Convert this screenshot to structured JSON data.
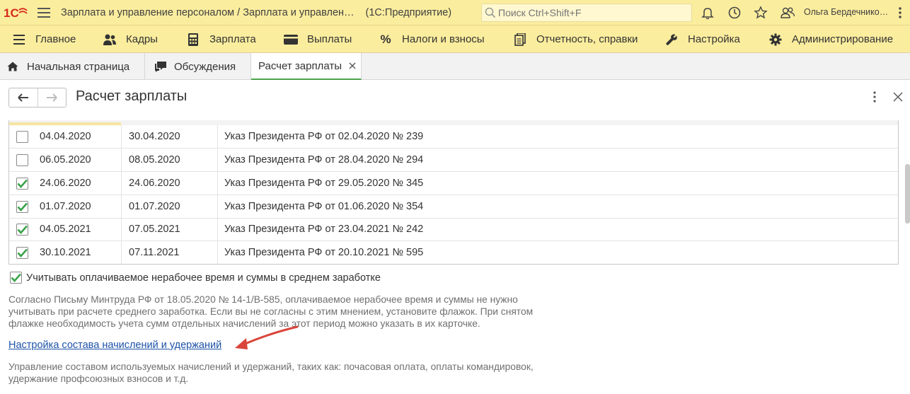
{
  "app": {
    "logo_text": "1С",
    "title": "Зарплата и управление персоналом / Зарплата и управлен…",
    "platform": "(1С:Предприятие)",
    "search_placeholder": "Поиск Ctrl+Shift+F",
    "user": "Ольга Бердечнико…"
  },
  "sections": [
    {
      "label": "Главное",
      "icon": "list-icon"
    },
    {
      "label": "Кадры",
      "icon": "people-icon"
    },
    {
      "label": "Зарплата",
      "icon": "calculator-icon"
    },
    {
      "label": "Выплаты",
      "icon": "wallet-icon"
    },
    {
      "label": "Налоги и взносы",
      "icon": "percent-icon"
    },
    {
      "label": "Отчетность, справки",
      "icon": "documents-icon"
    },
    {
      "label": "Настройка",
      "icon": "wrench-icon"
    },
    {
      "label": "Администрирование",
      "icon": "gear-icon"
    }
  ],
  "tabs": [
    {
      "label": "Начальная страница",
      "icon": "home-icon"
    },
    {
      "label": "Обсуждения",
      "icon": "chat-icon"
    },
    {
      "label": "Расчет зарплаты",
      "active": true
    }
  ],
  "form": {
    "title": "Расчет зарплаты"
  },
  "rows": [
    {
      "checked": false,
      "date_from": "04.04.2020",
      "date_to": "30.04.2020",
      "document": "Указ Президента РФ от 02.04.2020 № 239"
    },
    {
      "checked": false,
      "date_from": "06.05.2020",
      "date_to": "08.05.2020",
      "document": "Указ Президента РФ от 28.04.2020 № 294"
    },
    {
      "checked": true,
      "date_from": "24.06.2020",
      "date_to": "24.06.2020",
      "document": "Указ Президента РФ от 29.05.2020 № 345"
    },
    {
      "checked": true,
      "date_from": "01.07.2020",
      "date_to": "01.07.2020",
      "document": "Указ Президента РФ от 01.06.2020 № 354"
    },
    {
      "checked": true,
      "date_from": "04.05.2021",
      "date_to": "07.05.2021",
      "document": "Указ Президента РФ от 23.04.2021 № 242"
    },
    {
      "checked": true,
      "date_from": "30.10.2021",
      "date_to": "07.11.2021",
      "document": "Указ Президента РФ от 20.10.2021 № 595"
    }
  ],
  "option": {
    "checked": true,
    "label": "Учитывать оплачиваемое нерабочее время и суммы в среднем заработке"
  },
  "note1": [
    "Согласно Письму Минтруда РФ от 18.05.2020 № 14-1/В-585, оплачиваемое нерабочее время и суммы не нужно",
    "учитывать при расчете среднего заработка. Если вы не согласны с этим мнением, установите флажок. При снятом",
    "флажке необходимость учета сумм отдельных начислений за этот период можно указать в их карточке."
  ],
  "link": "Настройка состава начислений и удержаний",
  "note2": [
    "Управление составом используемых начислений и удержаний, таких как: почасовая оплата, оплаты командировок,",
    "удержание профсоюзных взносов и т.д."
  ],
  "colors": {
    "header_bg": "#fbed9e",
    "check_green": "#3aa24a",
    "link_blue": "#1d52a8",
    "annotation_arrow": "#d9453a"
  }
}
